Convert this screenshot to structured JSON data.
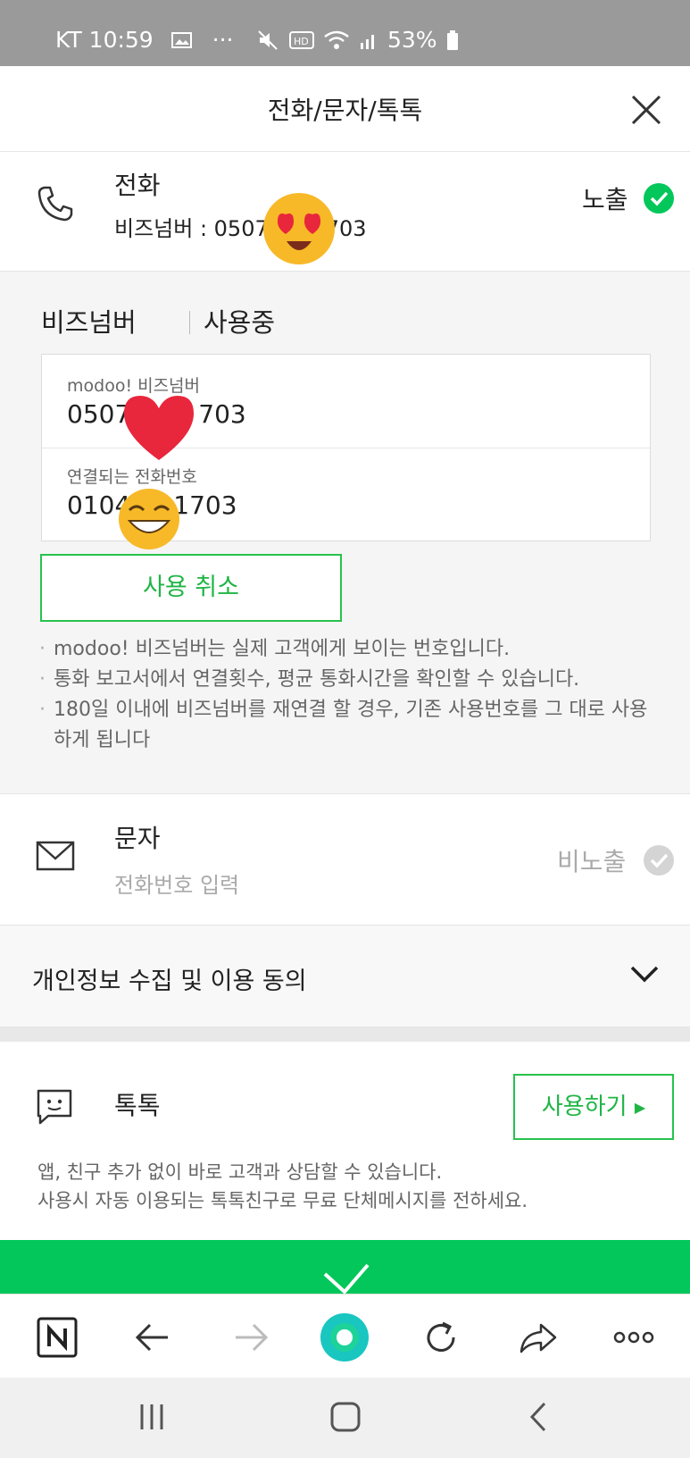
{
  "status_bar": {
    "carrier_time": "KT 10:59",
    "dots": "···",
    "battery": "53%"
  },
  "header": {
    "title": "전화/문자/톡톡"
  },
  "phone": {
    "title": "전화",
    "biz_number_line": "비즈넘버 : 0507",
    "biz_number_tail": "703",
    "exposure": "노출"
  },
  "biz_number": {
    "title": "비즈넘버",
    "status": "사용중",
    "modoo_caption": "modoo! 비즈넘버",
    "modoo_prefix": "0507",
    "modoo_tail": "703",
    "linked_caption": "연결되는 전화번호",
    "linked_prefix": "0104",
    "linked_tail": "1703",
    "cancel_label": "사용 취소",
    "notes": [
      "modoo! 비즈넘버는 실제 고객에게 보이는 번호입니다.",
      "통화 보고서에서 연결횟수, 평균 통화시간을 확인할 수 있습니다.",
      "180일 이내에 비즈넘버를 재연결 할 경우, 기존 사용번호를 그 대로 사용하게 됩니다"
    ]
  },
  "sms": {
    "title": "문자",
    "placeholder": "전화번호 입력",
    "exposure": "비노출"
  },
  "consent": {
    "label": "개인정보 수집 및 이용 동의"
  },
  "talktalk": {
    "title": "톡톡",
    "use_label": "사용하기",
    "desc_1": "앱, 친구 추가 없이 바로 고객과 상담할 수 있습니다.",
    "desc_2": "사용시 자동 이용되는 톡톡친구로 무료 단체메시지를 전하세요."
  },
  "icons": {
    "close": "close-icon",
    "phone": "phone-icon",
    "check": "check-circle-icon",
    "mail": "mail-icon",
    "chevron": "chevron-down-icon",
    "chat": "chat-icon"
  },
  "colors": {
    "accent": "#03c75a",
    "border_green": "#27c24c",
    "muted_check": "#d0d0d0"
  }
}
